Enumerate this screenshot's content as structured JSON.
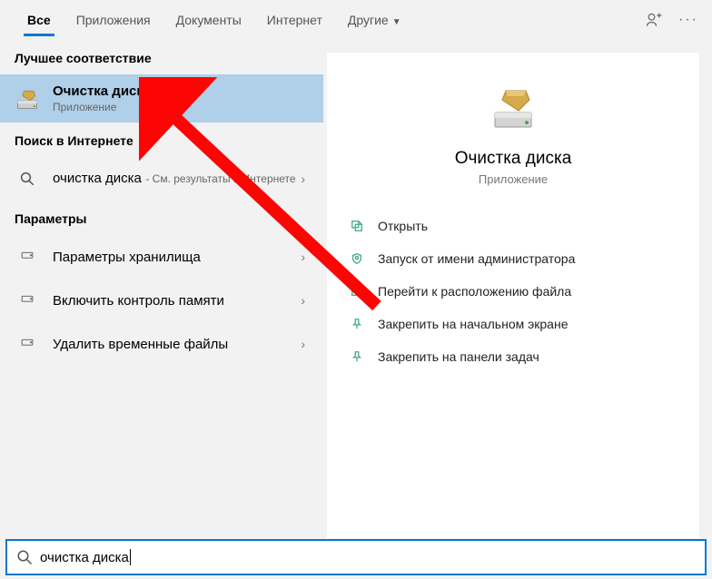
{
  "tabs": {
    "items": [
      {
        "label": "Все",
        "active": true
      },
      {
        "label": "Приложения",
        "active": false
      },
      {
        "label": "Документы",
        "active": false
      },
      {
        "label": "Интернет",
        "active": false
      },
      {
        "label": "Другие",
        "active": false,
        "dropdown": true
      }
    ]
  },
  "left": {
    "best_match_title": "Лучшее соответствие",
    "best_match": {
      "title": "Очистка диска",
      "subtitle": "Приложение"
    },
    "web_title": "Поиск в Интернете",
    "web": {
      "title": "очистка диска",
      "subtitle": "См. результаты в Интернете",
      "subtitle_prefix": " - "
    },
    "settings_title": "Параметры",
    "settings": [
      {
        "label": "Параметры хранилища"
      },
      {
        "label": "Включить контроль памяти"
      },
      {
        "label": "Удалить временные файлы"
      }
    ]
  },
  "preview": {
    "title": "Очистка диска",
    "subtitle": "Приложение"
  },
  "actions": [
    {
      "label": "Открыть",
      "icon": "open"
    },
    {
      "label": "Запуск от имени администратора",
      "icon": "admin"
    },
    {
      "label": "Перейти к расположению файла",
      "icon": "folder"
    },
    {
      "label": "Закрепить на начальном экране",
      "icon": "pin"
    },
    {
      "label": "Закрепить на панели задач",
      "icon": "pin"
    }
  ],
  "search": {
    "value": "очистка диска"
  },
  "colors": {
    "accent": "#0078d4",
    "highlight": "#b0cfe8",
    "arrow": "#fc0505"
  }
}
